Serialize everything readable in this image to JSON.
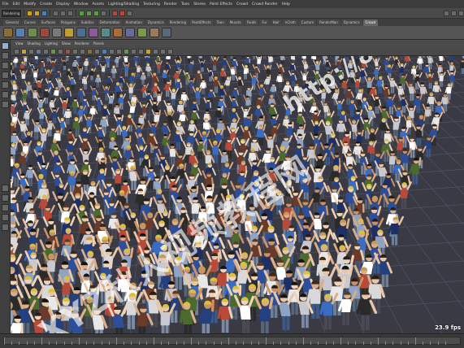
{
  "menubar": {
    "items": [
      "File",
      "Edit",
      "Modify",
      "Create",
      "Display",
      "Window",
      "Assets",
      "Lighting/Shading",
      "Texturing",
      "Render",
      "Toon",
      "Stereo",
      "Paint Effects",
      "Crowd",
      "Crowd Render",
      "Help"
    ]
  },
  "status_line": {
    "mode": "Rendering"
  },
  "shelf_tabs": {
    "items": [
      "General",
      "Curves",
      "Surfaces",
      "Polygons",
      "Subdivs",
      "Deformation",
      "Animation",
      "Dynamics",
      "Rendering",
      "PaintEffects",
      "Toon",
      "Muscle",
      "Fluids",
      "Fur",
      "Hair",
      "nCloth",
      "Custom",
      "RenderMan",
      "Dynamics",
      "Crowd"
    ],
    "active": "Crowd"
  },
  "panel_menu": {
    "items": [
      "View",
      "Shading",
      "Lighting",
      "Show",
      "Renderer",
      "Panels"
    ]
  },
  "viewport": {
    "fps": "23.9 fps",
    "watermark_url": "http://81.to",
    "watermark_cn": "XYZ秋人视频教程网"
  },
  "colors": {
    "ui_dark": "#3c3c3c",
    "ui_mid": "#555555",
    "active_tab": "#666666",
    "ground": "#3a3a44",
    "accent_blue": "#2d4f9a"
  }
}
